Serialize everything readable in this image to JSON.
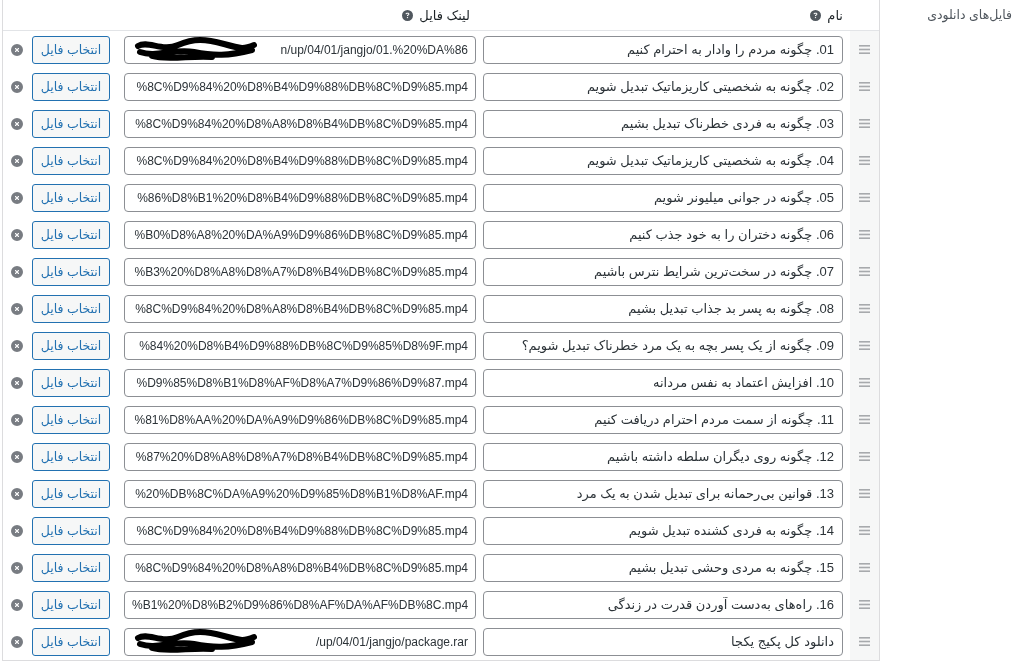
{
  "section_label": "فایل‌های دانلودی",
  "table": {
    "columns": [
      {
        "label": "نام"
      },
      {
        "label": "لینک فایل"
      }
    ],
    "rows": [
      {
        "name": "01. چگونه مردم را وادار به احترام کنیم",
        "file_url": "n/up/04/01/jangjo/01.%20%DA%86",
        "redacted": true,
        "button": "انتخاب فایل"
      },
      {
        "name": "02. چگونه به شخصیتی کاریزماتیک تبدیل شویم",
        "file_url": "%8C%D9%84%20%D8%B4%D9%88%DB%8C%D9%85.mp4",
        "redacted": false,
        "button": "انتخاب فایل"
      },
      {
        "name": "03. چگونه به فردی خطرناک تبدیل بشیم",
        "file_url": "%8C%D9%84%20%D8%A8%D8%B4%DB%8C%D9%85.mp4",
        "redacted": false,
        "button": "انتخاب فایل"
      },
      {
        "name": "04. چگونه به شخصیتی کاریزماتیک تبدیل شویم",
        "file_url": "%8C%D9%84%20%D8%B4%D9%88%DB%8C%D9%85.mp4",
        "redacted": false,
        "button": "انتخاب فایل"
      },
      {
        "name": "05. چگونه در جوانی میلیونر شویم",
        "file_url": "%86%D8%B1%20%D8%B4%D9%88%DB%8C%D9%85.mp4",
        "redacted": false,
        "button": "انتخاب فایل"
      },
      {
        "name": "06. چگونه دختران را به خود جذب کنیم",
        "file_url": "%B0%D8%A8%20%DA%A9%D9%86%DB%8C%D9%85.mp4",
        "redacted": false,
        "button": "انتخاب فایل"
      },
      {
        "name": "07. چگونه در سخت‌ترین شرایط نترس باشیم",
        "file_url": "%B3%20%D8%A8%D8%A7%D8%B4%DB%8C%D9%85.mp4",
        "redacted": false,
        "button": "انتخاب فایل"
      },
      {
        "name": "08. چگونه به پسر بد جذاب تبدیل بشیم",
        "file_url": "%8C%D9%84%20%D8%A8%D8%B4%DB%8C%D9%85.mp4",
        "redacted": false,
        "button": "انتخاب فایل"
      },
      {
        "name": "09. چگونه از یک پسر بچه به یک مرد خطرناک تبدیل شویم؟",
        "file_url": "%84%20%D8%B4%D9%88%DB%8C%D9%85%D8%9F.mp4",
        "redacted": false,
        "button": "انتخاب فایل"
      },
      {
        "name": "10. افزایش اعتماد به نفس مردانه",
        "file_url": "%D9%85%D8%B1%D8%AF%D8%A7%D9%86%D9%87.mp4",
        "redacted": false,
        "button": "انتخاب فایل"
      },
      {
        "name": "11. چگونه از سمت مردم احترام دریافت کنیم",
        "file_url": "%81%D8%AA%20%DA%A9%D9%86%DB%8C%D9%85.mp4",
        "redacted": false,
        "button": "انتخاب فایل"
      },
      {
        "name": "12. چگونه روی دیگران سلطه داشته باشیم",
        "file_url": "%87%20%D8%A8%D8%A7%D8%B4%DB%8C%D9%85.mp4",
        "redacted": false,
        "button": "انتخاب فایل"
      },
      {
        "name": "13. قوانین بی‌رحمانه برای تبدیل شدن به یک مرد",
        "file_url": "%20%DB%8C%DA%A9%20%D9%85%D8%B1%D8%AF.mp4",
        "redacted": false,
        "button": "انتخاب فایل"
      },
      {
        "name": "14. چگونه به فردی کشنده تبدیل شویم",
        "file_url": "%8C%D9%84%20%D8%B4%D9%88%DB%8C%D9%85.mp4",
        "redacted": false,
        "button": "انتخاب فایل"
      },
      {
        "name": "15. چگونه به مردی وحشی تبدیل بشیم",
        "file_url": "%8C%D9%84%20%D8%A8%D8%B4%DB%8C%D9%85.mp4",
        "redacted": false,
        "button": "انتخاب فایل"
      },
      {
        "name": "16. راه‌های به‌دست آوردن قدرت در زندگی",
        "file_url": "%B1%20%D8%B2%D9%86%D8%AF%DA%AF%DB%8C.mp4",
        "redacted": false,
        "button": "انتخاب فایل"
      },
      {
        "name": "دانلود کل پکیج یکجا",
        "file_url": "/up/04/01/jangjo/package.rar",
        "redacted": true,
        "button": "انتخاب فایل"
      }
    ]
  }
}
